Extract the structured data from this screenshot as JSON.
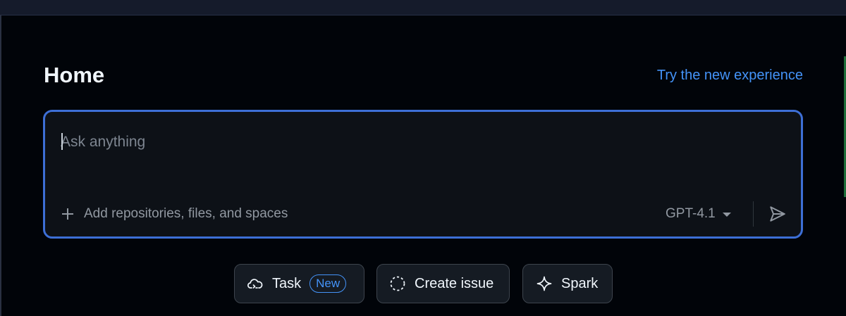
{
  "page": {
    "title": "Home",
    "try_link": "Try the new experience"
  },
  "composer": {
    "placeholder": "Ask anything",
    "value": "",
    "add_context_label": "Add repositories, files, and spaces",
    "model": "GPT-4.1"
  },
  "actions": [
    {
      "label": "Task",
      "icon": "cloud-agent-icon",
      "badge": "New"
    },
    {
      "label": "Create issue",
      "icon": "issue-dashed-circle-icon"
    },
    {
      "label": "Spark",
      "icon": "sparkle-icon"
    }
  ],
  "colors": {
    "background": "#010409",
    "accent": "#4493f8",
    "focus_border": "#3d6fd6",
    "text_primary": "#f0f6fc",
    "text_muted": "#9198a1"
  }
}
